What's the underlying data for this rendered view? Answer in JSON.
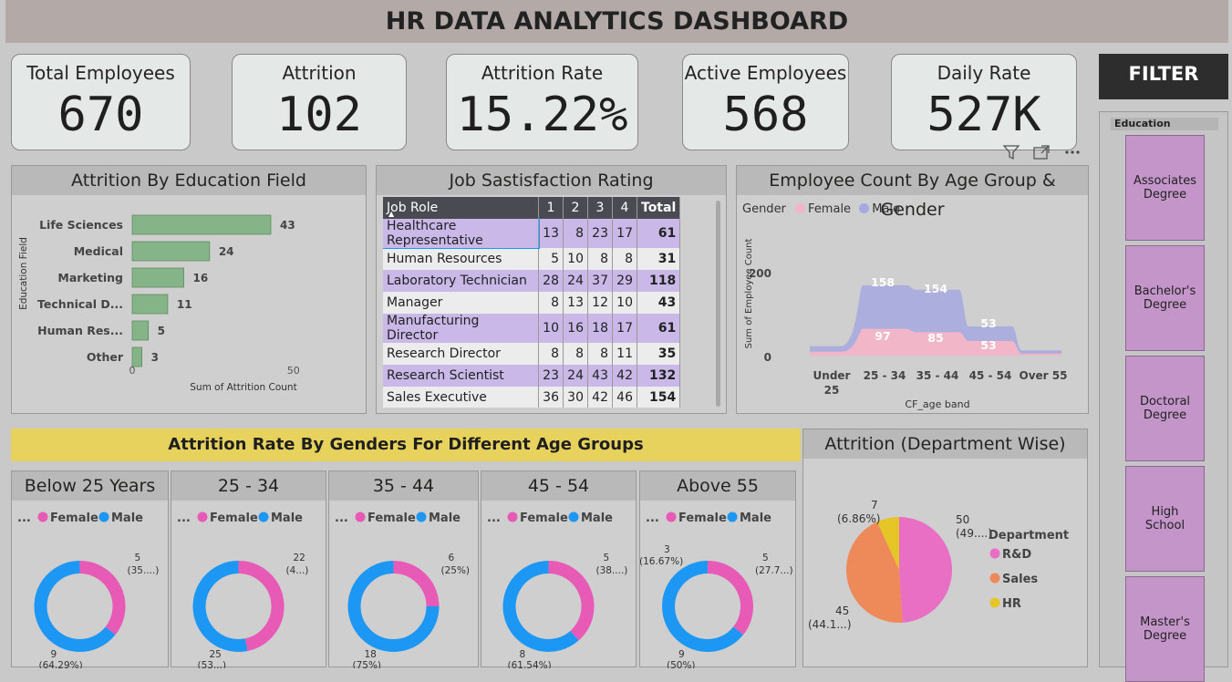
{
  "title": "HR DATA ANALYTICS DASHBOARD",
  "kpis": [
    {
      "label": "Total Employees",
      "value": "670"
    },
    {
      "label": "Attrition",
      "value": "102"
    },
    {
      "label": "Attrition Rate",
      "value": "15.22%"
    },
    {
      "label": "Active Employees",
      "value": "568"
    },
    {
      "label": "Daily Rate",
      "value": "527K"
    }
  ],
  "filter": {
    "title": "FILTER",
    "slicer_header": "Education",
    "options": [
      "Associates Degree",
      "Bachelor's Degree",
      "Doctoral Degree",
      "High School",
      "Master's Degree"
    ]
  },
  "colors": {
    "bar": "#86b489",
    "female": "#e75ab5",
    "male": "#1d97f4",
    "area_female": "#f4b6c6",
    "area_male": "#a6a8e0",
    "rd": "#e86fc4",
    "sales": "#ee8a5a",
    "hr": "#e6c526"
  },
  "chart_data": [
    {
      "type": "bar",
      "title": "Attrition By Education Field",
      "categories": [
        "Life Sciences",
        "Medical",
        "Marketing",
        "Technical D...",
        "Human Res...",
        "Other"
      ],
      "values": [
        43,
        24,
        16,
        11,
        5,
        3
      ],
      "xlabel": "Sum of Attrition Count",
      "ylabel": "Education Field",
      "xticks": [
        "0",
        "50"
      ],
      "xlim": [
        0,
        58
      ]
    },
    {
      "type": "table",
      "title": "Job Sastisfaction Rating",
      "columns": [
        "Job Role",
        "1",
        "2",
        "3",
        "4",
        "Total"
      ],
      "rows": [
        [
          "Healthcare Representative",
          "13",
          "8",
          "23",
          "17",
          "61"
        ],
        [
          "Human Resources",
          "5",
          "10",
          "8",
          "8",
          "31"
        ],
        [
          "Laboratory Technician",
          "28",
          "24",
          "37",
          "29",
          "118"
        ],
        [
          "Manager",
          "8",
          "13",
          "12",
          "10",
          "43"
        ],
        [
          "Manufacturing Director",
          "10",
          "16",
          "18",
          "17",
          "61"
        ],
        [
          "Research Director",
          "8",
          "8",
          "8",
          "11",
          "35"
        ],
        [
          "Research Scientist",
          "23",
          "24",
          "43",
          "42",
          "132"
        ],
        [
          "Sales Executive",
          "36",
          "30",
          "42",
          "46",
          "154"
        ]
      ]
    },
    {
      "type": "area",
      "title": "Employee Count By Age Group & Gender",
      "legend_title": "Gender",
      "categories": [
        "Under 25",
        "25 - 34",
        "35 - 44",
        "45 - 54",
        "Over 55"
      ],
      "series": [
        {
          "name": "Female",
          "values": [
            14,
            97,
            85,
            53,
            7
          ]
        },
        {
          "name": "Male",
          "values": [
            20,
            158,
            154,
            53,
            12
          ]
        }
      ],
      "data_labels": [
        "97",
        "158",
        "85",
        "154",
        "53",
        "53"
      ],
      "xlabel": "CF_age band",
      "ylabel": "Sum of Employee Count",
      "yticks": [
        "0",
        "200"
      ],
      "ylim": [
        0,
        270
      ]
    },
    {
      "type": "pie",
      "title": "Below 25 Years",
      "legend_title": "...",
      "legend": [
        "Female",
        "Male"
      ],
      "values": [
        5,
        9
      ],
      "labels": [
        "5",
        "9"
      ],
      "pct_labels": [
        "(35....)",
        "(64.29%)"
      ]
    },
    {
      "type": "pie",
      "title": "25 - 34",
      "legend_title": "...",
      "legend": [
        "Female",
        "Male"
      ],
      "values": [
        22,
        25
      ],
      "labels": [
        "22",
        "25"
      ],
      "pct_labels": [
        "(4...)",
        "(53...)"
      ]
    },
    {
      "type": "pie",
      "title": "35 - 44",
      "legend_title": "...",
      "legend": [
        "Female",
        "Male"
      ],
      "values": [
        6,
        18
      ],
      "labels": [
        "6",
        "18"
      ],
      "pct_labels": [
        "(25%)",
        "(75%)"
      ]
    },
    {
      "type": "pie",
      "title": "45 - 54",
      "legend_title": "...",
      "legend": [
        "Female",
        "Male"
      ],
      "values": [
        5,
        8
      ],
      "labels": [
        "5",
        "8"
      ],
      "pct_labels": [
        "(38....)",
        "(61.54%)"
      ]
    },
    {
      "type": "pie",
      "title": "Above 55",
      "legend_title": "...",
      "legend": [
        "Female",
        "Male"
      ],
      "values": [
        5,
        9,
        3
      ],
      "labels": [
        "5",
        "9",
        "3"
      ],
      "pct_labels": [
        "(27.7...)",
        "(50%)",
        "(16.67%)"
      ]
    },
    {
      "type": "pie",
      "title": "Attrition (Department Wise)",
      "legend_title": "Department",
      "legend": [
        "R&D",
        "Sales",
        "HR"
      ],
      "values": [
        50,
        45,
        7
      ],
      "labels": [
        "50",
        "45",
        "7"
      ],
      "pct_labels": [
        "(49....)",
        "(44.1...)",
        "(6.86%)"
      ]
    }
  ],
  "banner": "Attrition Rate By Genders For Different Age Groups"
}
